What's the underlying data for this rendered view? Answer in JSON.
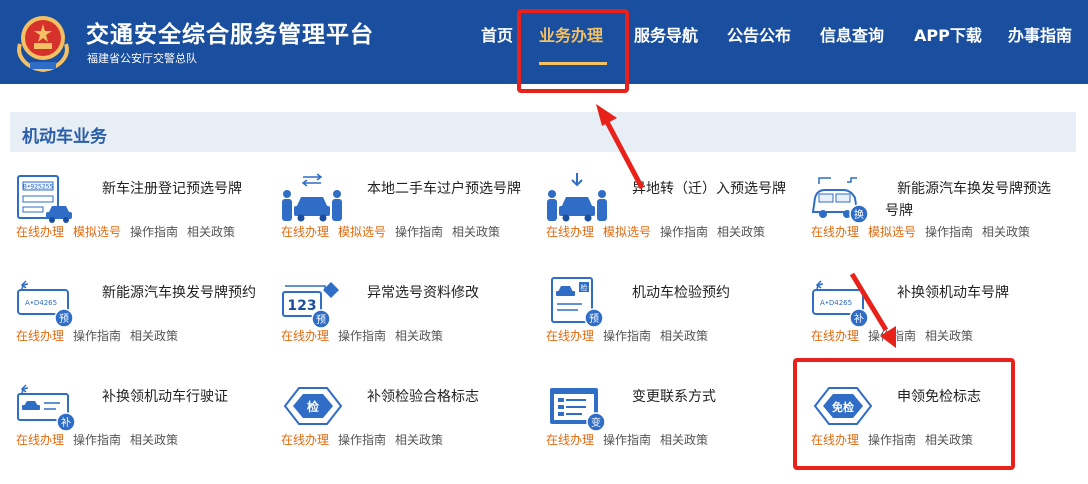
{
  "header": {
    "title": "交通安全综合服务管理平台",
    "subtitle": "福建省公安厅交警总队",
    "nav": [
      {
        "label": "首页",
        "active": false
      },
      {
        "label": "业务办理",
        "active": true
      },
      {
        "label": "服务导航",
        "active": false
      },
      {
        "label": "公告公布",
        "active": false
      },
      {
        "label": "信息查询",
        "active": false
      },
      {
        "label": "APP下载",
        "active": false
      },
      {
        "label": "办事指南",
        "active": false
      }
    ],
    "accent_color": "#1a4e9e",
    "active_color": "#f3c163"
  },
  "section": {
    "title": "机动车业务"
  },
  "services": [
    {
      "name": "新车注册登记预选号牌",
      "icon": "new-car-registration-icon",
      "badge": "",
      "actions": [
        "在线办理",
        "模拟选号",
        "操作指南",
        "相关政策"
      ]
    },
    {
      "name": "本地二手车过户预选号牌",
      "icon": "used-car-transfer-icon",
      "badge": "",
      "actions": [
        "在线办理",
        "模拟选号",
        "操作指南",
        "相关政策"
      ]
    },
    {
      "name": "异地转（迁）入预选号牌",
      "icon": "car-transfer-in-icon",
      "badge": "",
      "actions": [
        "在线办理",
        "模拟选号",
        "操作指南",
        "相关政策"
      ]
    },
    {
      "name": "新能源汽车换发号牌预选号牌",
      "icon": "ev-plate-exchange-icon",
      "badge": "换",
      "actions": [
        "在线办理",
        "模拟选号",
        "操作指南",
        "相关政策"
      ]
    },
    {
      "name": "新能源汽车换发号牌预约",
      "icon": "ev-plate-appointment-icon",
      "badge": "预",
      "plate": "A•D4265",
      "actions": [
        "在线办理",
        "操作指南",
        "相关政策"
      ]
    },
    {
      "name": "异常选号资料修改",
      "icon": "plate-number-edit-icon",
      "badge": "预",
      "plate": "123",
      "actions": [
        "在线办理",
        "操作指南",
        "相关政策"
      ]
    },
    {
      "name": "机动车检验预约",
      "icon": "vehicle-inspection-icon",
      "badge": "预",
      "tag": "检",
      "actions": [
        "在线办理",
        "操作指南",
        "相关政策"
      ]
    },
    {
      "name": "补换领机动车号牌",
      "icon": "plate-replacement-icon",
      "badge": "补",
      "plate": "A•D4265",
      "actions": [
        "在线办理",
        "操作指南",
        "相关政策"
      ]
    },
    {
      "name": "补换领机动车行驶证",
      "icon": "license-replacement-icon",
      "badge": "补",
      "actions": [
        "在线办理",
        "操作指南",
        "相关政策"
      ]
    },
    {
      "name": "补领检验合格标志",
      "icon": "inspection-mark-icon",
      "badge": "检",
      "actions": [
        "在线办理",
        "操作指南",
        "相关政策"
      ]
    },
    {
      "name": "变更联系方式",
      "icon": "contact-change-icon",
      "badge": "变",
      "actions": [
        "在线办理",
        "操作指南",
        "相关政策"
      ]
    },
    {
      "name": "申领免检标志",
      "icon": "exemption-mark-icon",
      "badge": "免检",
      "actions": [
        "在线办理",
        "操作指南",
        "相关政策"
      ]
    }
  ],
  "plate_text": "B•925255",
  "annotation_color": "#e8221a"
}
